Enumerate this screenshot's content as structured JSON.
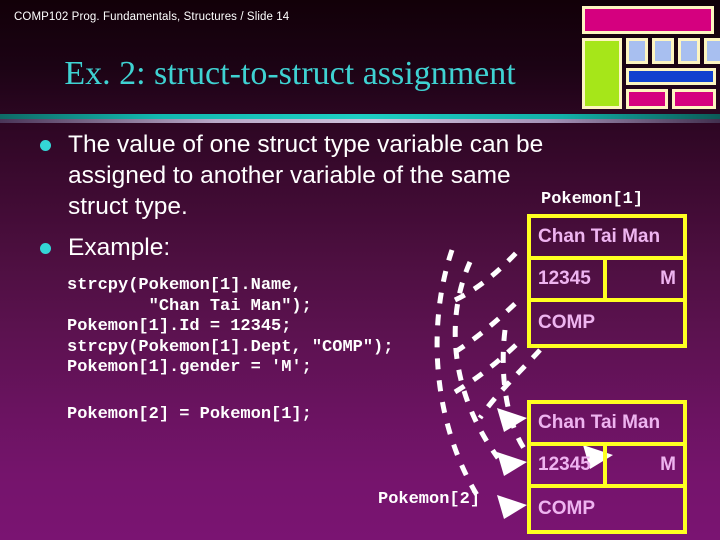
{
  "header": {
    "text": "COMP102 Prog. Fundamentals, Structures / Slide 14"
  },
  "title": {
    "text": "Ex. 2: struct-to-struct assignment",
    "color": "#3fd2d2"
  },
  "bullets": [
    {
      "text": "The value of one struct type variable can be assigned to another variable of the same struct type."
    },
    {
      "text": "Example:"
    }
  ],
  "code_blocks": [
    {
      "text": "strcpy(Pokemon[1].Name,\n        \"Chan Tai Man\");\nPokemon[1].Id = 12345;\nstrcpy(Pokemon[1].Dept, \"COMP\");\nPokemon[1].gender = 'M';"
    },
    {
      "text": "Pokemon[2] = Pokemon[1];"
    }
  ],
  "structs": [
    {
      "label": "Pokemon[1]",
      "rows": [
        {
          "cells": [
            {
              "value": "Chan Tai Man",
              "align": "left"
            }
          ]
        },
        {
          "cells": [
            {
              "value": "12345",
              "align": "left"
            },
            {
              "value": "M",
              "align": "right"
            }
          ]
        },
        {
          "cells": [
            {
              "value": "COMP",
              "align": "left"
            }
          ]
        }
      ]
    },
    {
      "label": "Pokemon[2]",
      "rows": [
        {
          "cells": [
            {
              "value": "Chan Tai Man",
              "align": "left"
            }
          ]
        },
        {
          "cells": [
            {
              "value": "12345",
              "align": "left"
            },
            {
              "value": "M",
              "align": "right"
            }
          ]
        },
        {
          "cells": [
            {
              "value": "COMP",
              "align": "left"
            }
          ]
        }
      ]
    }
  ],
  "colors": {
    "border_yellow": "#ffff21",
    "cell_text": "#eeb4f0",
    "bullet_dot": "#34d6d6",
    "arrow_white": "#ffffff",
    "deco_magenta": "#d5007f",
    "deco_green": "#a6e619",
    "deco_blue": "#1241cf",
    "deco_lightblue": "#a8bff0",
    "deco_border": "#fdf5c0"
  },
  "decoration": {
    "name": "slide-corner-graphic",
    "shapes": [
      "magenta-bar",
      "green-block",
      "lightblue-square",
      "lightblue-square",
      "lightblue-square",
      "lightblue-square",
      "blue-bar",
      "magenta-block",
      "magenta-block"
    ]
  }
}
